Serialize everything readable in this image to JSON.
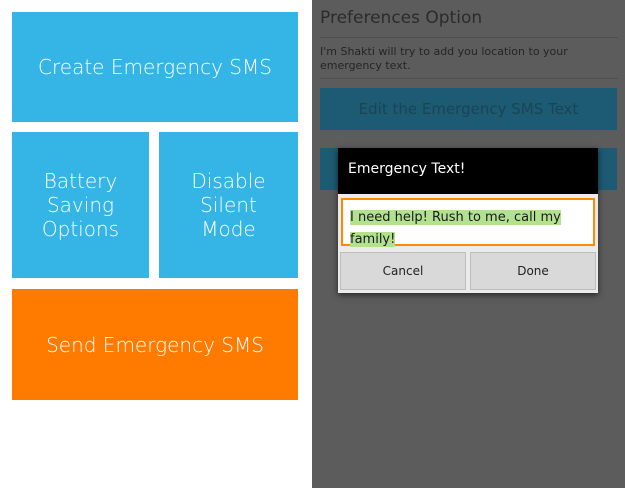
{
  "home": {
    "create_label": "Create Emergency SMS",
    "battery_label": "Battery\nSaving\nOptions",
    "silent_label": "Disable\nSilent\nMode",
    "send_label": "Send Emergency SMS"
  },
  "preferences": {
    "title": "Preferences Option",
    "description": "I'm Shakti will try to add you location to your emergency text.",
    "edit_button_label": "Edit the Emergency SMS Text"
  },
  "dialog": {
    "title": "Emergency Text!",
    "input_value": "I need help! Rush to me, call my family!",
    "cancel_label": "Cancel",
    "done_label": "Done"
  },
  "colors": {
    "tile_blue": "#35b5e5",
    "tile_orange": "#ff7b00",
    "dialog_input_border": "#ff8a00",
    "selection_highlight": "#b3e28f"
  }
}
